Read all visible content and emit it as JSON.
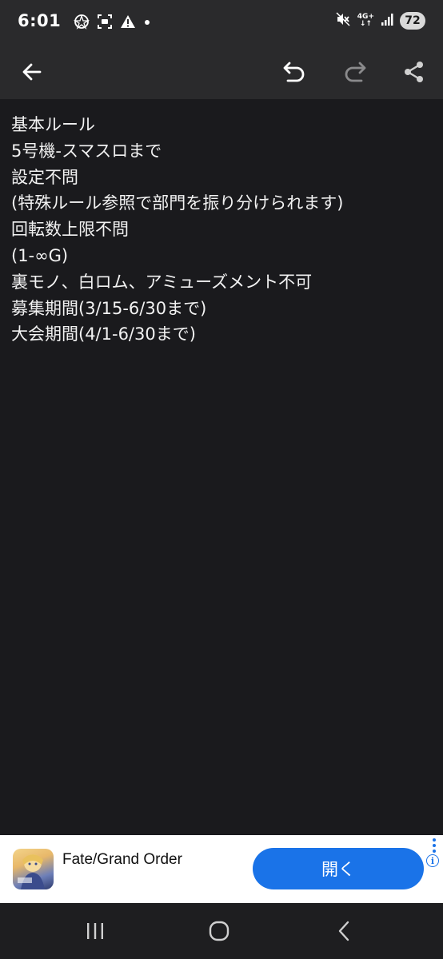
{
  "status_bar": {
    "time": "6:01",
    "battery": "72",
    "network_top": "4G+",
    "network_bottom": "↓↑"
  },
  "icons": {
    "back": "arrow-left-icon",
    "undo": "undo-icon",
    "redo": "redo-icon",
    "share": "share-icon"
  },
  "content": {
    "lines": [
      "基本ルール",
      "5号機-スマスロまで",
      "設定不問",
      "(特殊ルール参照で部門を振り分けられます)",
      "回転数上限不問",
      "(1-∞G)",
      "裏モノ、白ロム、アミューズメント不可",
      "募集期間(3/15-6/30まで)",
      "大会期間(4/1-6/30まで)"
    ]
  },
  "ad": {
    "title": "Fate/Grand Order",
    "button_label": "開く",
    "info_glyph": "i",
    "accent_color": "#1a73e8"
  },
  "colors": {
    "background": "#1a1a1d",
    "bar": "#2a2a2c",
    "text": "#f2f2f2"
  }
}
